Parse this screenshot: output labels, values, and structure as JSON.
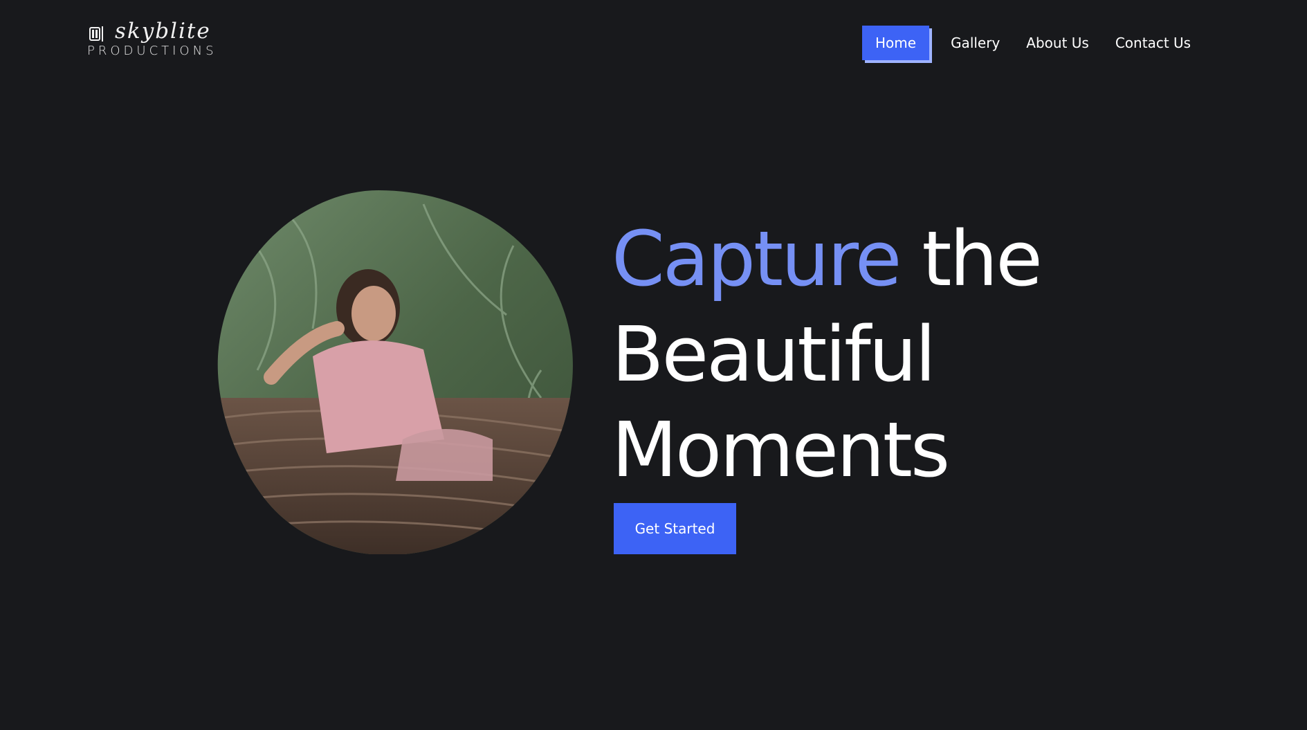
{
  "brand": {
    "logo_script": "skyblite",
    "logo_sub": "PRODUCTIONS"
  },
  "nav": {
    "items": [
      {
        "label": "Home",
        "active": true
      },
      {
        "label": "Gallery",
        "active": false
      },
      {
        "label": "About Us",
        "active": false
      },
      {
        "label": "Contact Us",
        "active": false
      }
    ]
  },
  "hero": {
    "headline_accent": "Capture",
    "headline_rest": "the",
    "headline_line2": "Beautiful",
    "headline_line3": "Moments",
    "cta_label": "Get Started"
  },
  "colors": {
    "background": "#18191c",
    "accent_blue": "#3d63f5",
    "headline_accent": "#7690f4",
    "text": "#ffffff"
  }
}
